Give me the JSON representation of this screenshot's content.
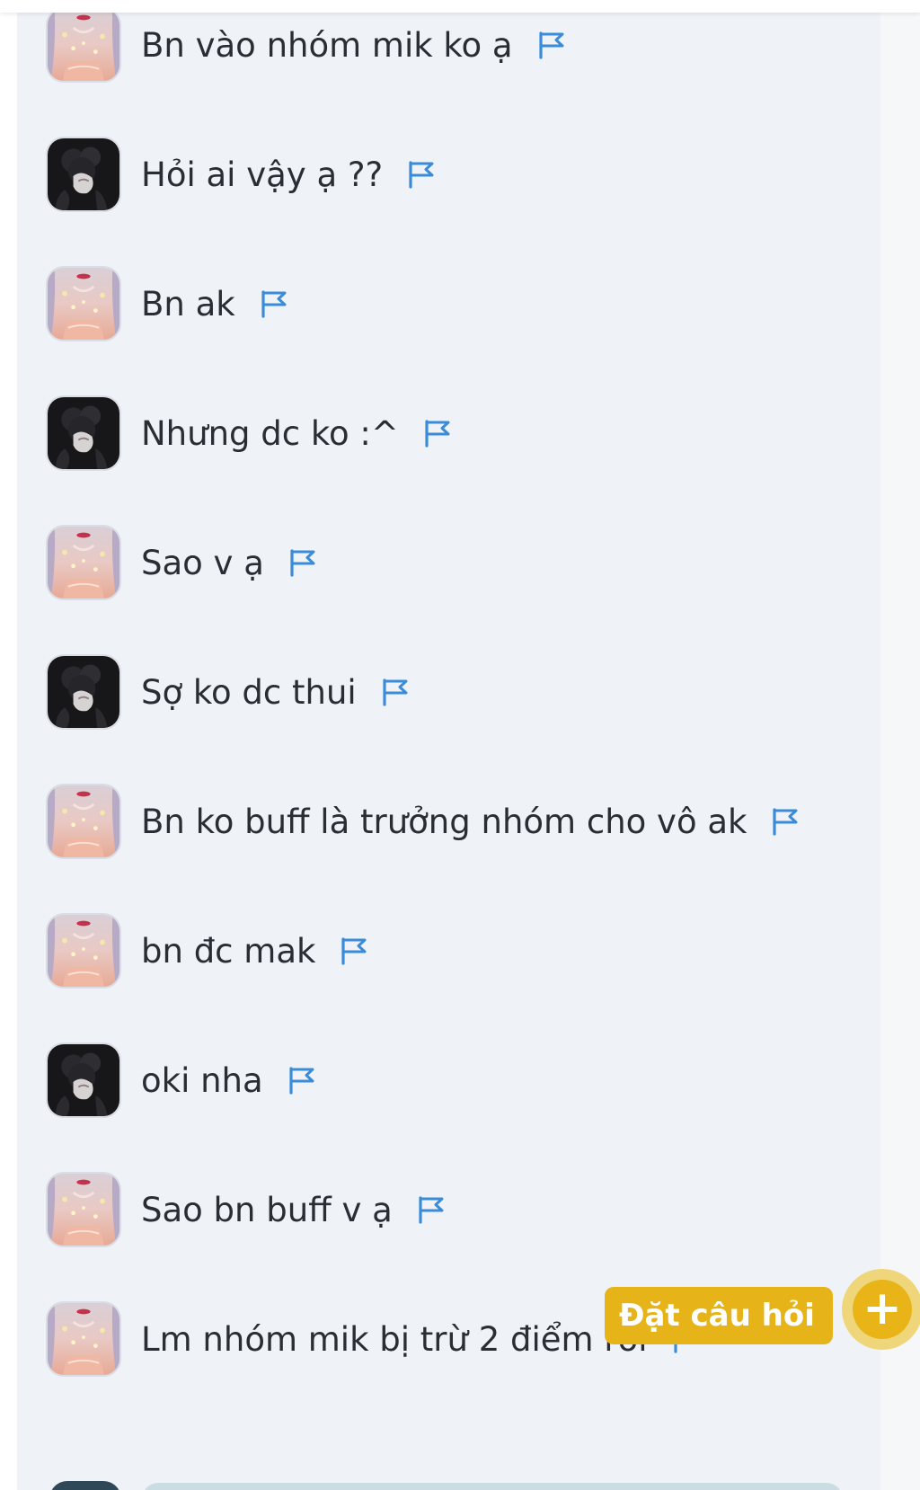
{
  "messages": [
    {
      "text": "Bn vào nhóm mik ko ạ",
      "avatar": "girl-avatar-icon"
    },
    {
      "text": "Hỏi ai vậy ạ ??",
      "avatar": "dark-avatar-icon"
    },
    {
      "text": "Bn ak",
      "avatar": "girl-avatar-icon"
    },
    {
      "text": "Nhưng dc ko :^",
      "avatar": "dark-avatar-icon"
    },
    {
      "text": "Sao v ạ",
      "avatar": "girl-avatar-icon"
    },
    {
      "text": "Sợ ko dc thui",
      "avatar": "dark-avatar-icon"
    },
    {
      "text": "Bn ko buff là trưởng nhóm cho vô ak",
      "avatar": "girl-avatar-icon"
    },
    {
      "text": "bn đc mak",
      "avatar": "girl-avatar-icon"
    },
    {
      "text": "oki nha",
      "avatar": "dark-avatar-icon"
    },
    {
      "text": "Sao bn buff v ạ",
      "avatar": "girl-avatar-icon"
    },
    {
      "text": "Lm nhóm mik bị trừ 2 điểm rồi",
      "avatar": "girl-avatar-icon"
    }
  ],
  "ask_button": {
    "label": "Đặt câu hỏi"
  },
  "fab": {
    "icon": "plus-icon"
  },
  "flag": {
    "icon": "flag-icon"
  },
  "colors": {
    "panel_bg": "#eff3f8",
    "flag_blue": "#3a8bd8",
    "accent_yellow": "#e6b319",
    "text": "#2a2d33"
  }
}
